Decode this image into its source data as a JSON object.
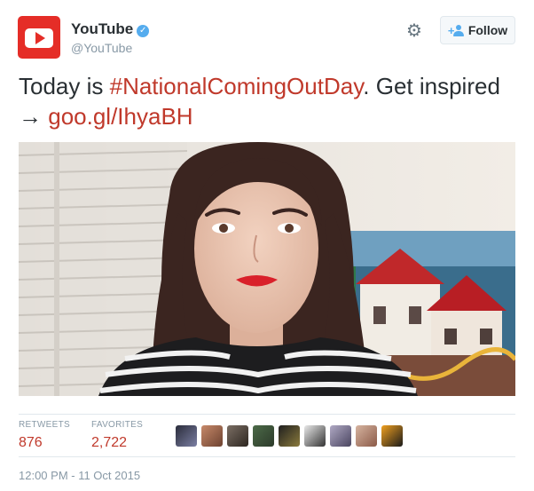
{
  "account": {
    "name": "YouTube",
    "handle": "@YouTube",
    "verified_mark": "✓",
    "brand_color": "#e52d27"
  },
  "actions": {
    "settings_icon": "gear-icon",
    "follow_label": "Follow"
  },
  "tweet": {
    "text_before": "Today is ",
    "hashtag": "#NationalComingOutDay",
    "text_middle": ". Get inspired → ",
    "link": "goo.gl/IhyaBH",
    "link_color": "#c0392b"
  },
  "stats": {
    "retweets_label": "RETWEETS",
    "retweets_value": "876",
    "favorites_label": "FAVORITES",
    "favorites_value": "2,722"
  },
  "timestamp": "12:00 PM - 11 Oct 2015"
}
